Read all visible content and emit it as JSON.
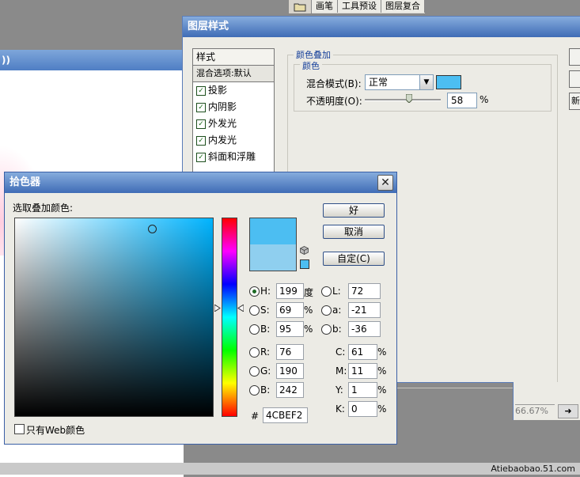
{
  "top_tabs": {
    "tabs": [
      "画笔",
      "工具预设",
      "图层复合"
    ]
  },
  "bg_window": {
    "title": "))"
  },
  "layer_style": {
    "title": "图层样式",
    "list": {
      "header": "样式",
      "blend": "混合选项:默认",
      "items": [
        "投影",
        "内阴影",
        "外发光",
        "内发光",
        "斜面和浮雕"
      ]
    },
    "group_outer": "颜色叠加",
    "group_inner": "颜色",
    "blend_mode_label": "混合模式(B):",
    "blend_mode_value": "正常",
    "opacity_label": "不透明度(O):",
    "opacity_value": "58",
    "opacity_unit": "%",
    "opacity_fraction": 0.58,
    "swatch_color": "#4CBEF2",
    "right_button_partial": "新"
  },
  "picker": {
    "title": "拾色器",
    "caption": "选取叠加颜色:",
    "ok": "好",
    "cancel": "取消",
    "custom": "自定(C)",
    "hsb": {
      "h": "199",
      "s": "69",
      "b": "95",
      "h_label": "H:",
      "s_label": "S:",
      "b_label": "B:",
      "h_unit": "度",
      "s_unit": "%",
      "b_unit": "%"
    },
    "rgb": {
      "r": "76",
      "g": "190",
      "b": "242",
      "r_label": "R:",
      "g_label": "G:",
      "b_label": "B:"
    },
    "lab": {
      "l": "72",
      "a": "-21",
      "b": "-36",
      "l_label": "L:",
      "a_label": "a:",
      "b_label": "b:"
    },
    "cmyk": {
      "c": "61",
      "m": "11",
      "y": "1",
      "k": "0",
      "c_label": "C:",
      "m_label": "M:",
      "y_label": "Y:",
      "k_label": "K:",
      "unit": "%"
    },
    "hex_label": "#",
    "hex": "4CBEF2",
    "web_only": "只有Web颜色",
    "new_color": "#4CBEF2",
    "old_color": "#8FCFEF",
    "hue_color": "#00B4FF"
  },
  "zoom": "66.67%",
  "credit": "Atiebaobao.51.com"
}
